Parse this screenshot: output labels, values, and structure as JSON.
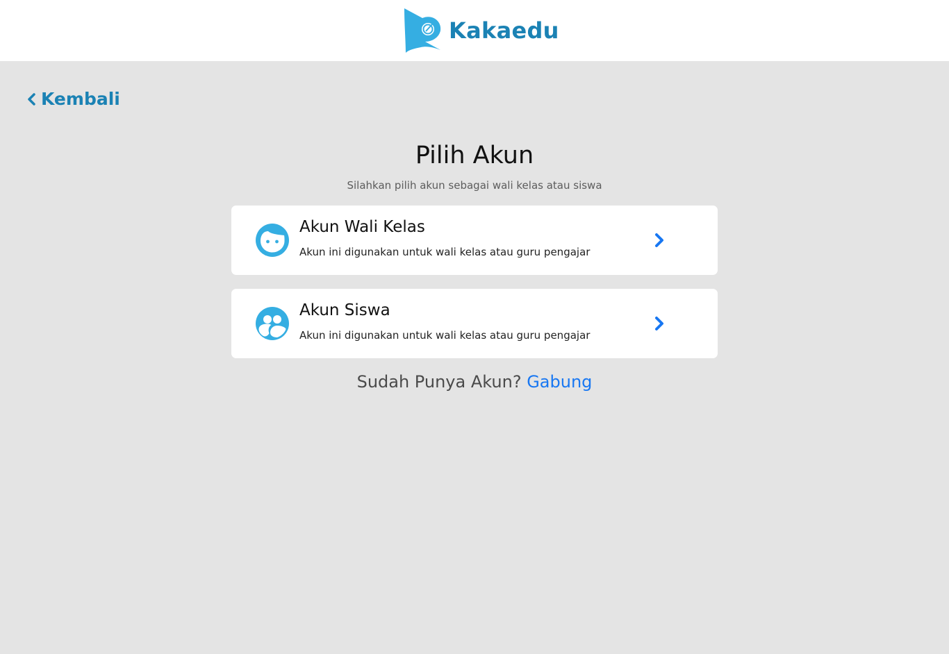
{
  "header": {
    "brand_name": "Kakaedu",
    "logo_icon": "kakaedu-logo-icon",
    "brand_color": "#1b82b4"
  },
  "nav": {
    "back_label": "Kembali",
    "back_icon": "chevron-left-icon"
  },
  "main": {
    "title": "Pilih Akun",
    "subtitle": "Silahkan pilih akun sebagai wali kelas atau siswa",
    "accounts": [
      {
        "title": "Akun Wali Kelas",
        "description": "Akun ini digunakan untuk wali kelas atau guru pengajar",
        "icon": "teacher-face-icon",
        "action_icon": "chevron-right-icon"
      },
      {
        "title": "Akun Siswa",
        "description": "Akun ini digunakan untuk wali kelas atau guru pengajar",
        "icon": "students-group-icon",
        "action_icon": "chevron-right-icon"
      }
    ]
  },
  "footer": {
    "prompt": "Sudah Punya Akun?",
    "link_label": "Gabung"
  },
  "colors": {
    "accent": "#1b82b4",
    "icon_blue": "#35aee2",
    "link_blue": "#1877f2",
    "page_background": "#e4e4e4",
    "card_background": "#ffffff"
  }
}
